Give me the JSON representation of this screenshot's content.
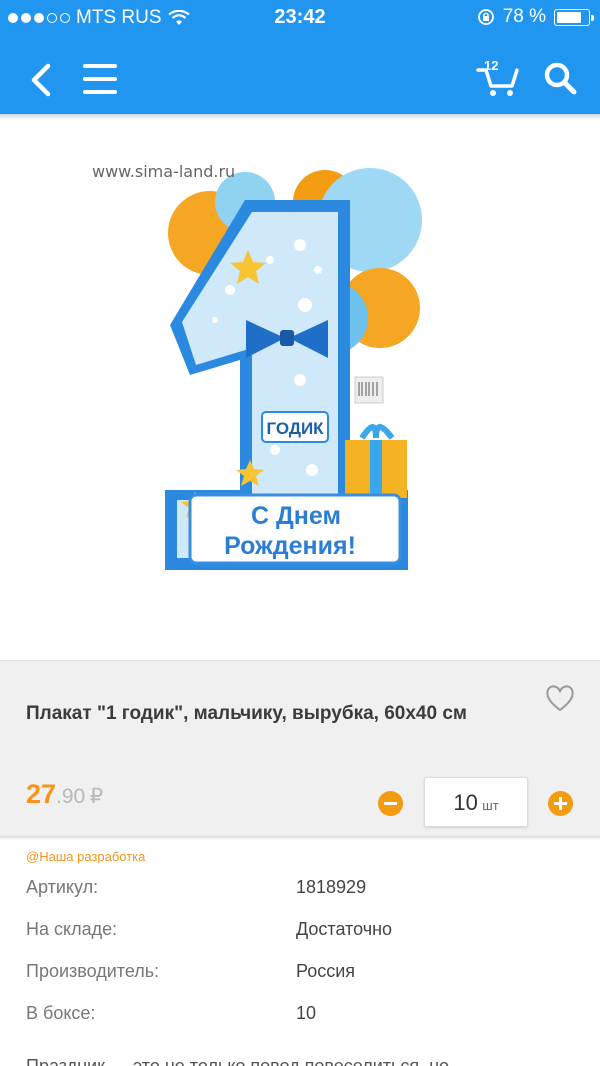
{
  "status_bar": {
    "carrier": "MTS RUS",
    "time": "23:42",
    "battery_percent": "78 %"
  },
  "nav": {
    "cart_count": "12"
  },
  "product": {
    "watermark": "www.sima-land.ru",
    "poster_tag_text": "ГОДИК",
    "poster_banner_line1": "С Днем",
    "poster_banner_line2": "Рождения!",
    "title": "Плакат \"1 годик\", мальчику, вырубка, 60х40 см",
    "price_int": "27",
    "price_dec": ".90",
    "currency": "₽",
    "quantity": "10",
    "quantity_unit": "шт",
    "tag": "@Наша разработка",
    "specs": [
      {
        "label": "Артикул:",
        "value": "1818929"
      },
      {
        "label": "На складе:",
        "value": "Достаточно"
      },
      {
        "label": "Производитель:",
        "value": "Россия"
      },
      {
        "label": "В боксе:",
        "value": "10"
      }
    ],
    "description_cut": "Праздник — это не только повод повеселиться, но"
  },
  "colors": {
    "accent_blue": "#2196f0",
    "accent_orange": "#f7941d"
  }
}
